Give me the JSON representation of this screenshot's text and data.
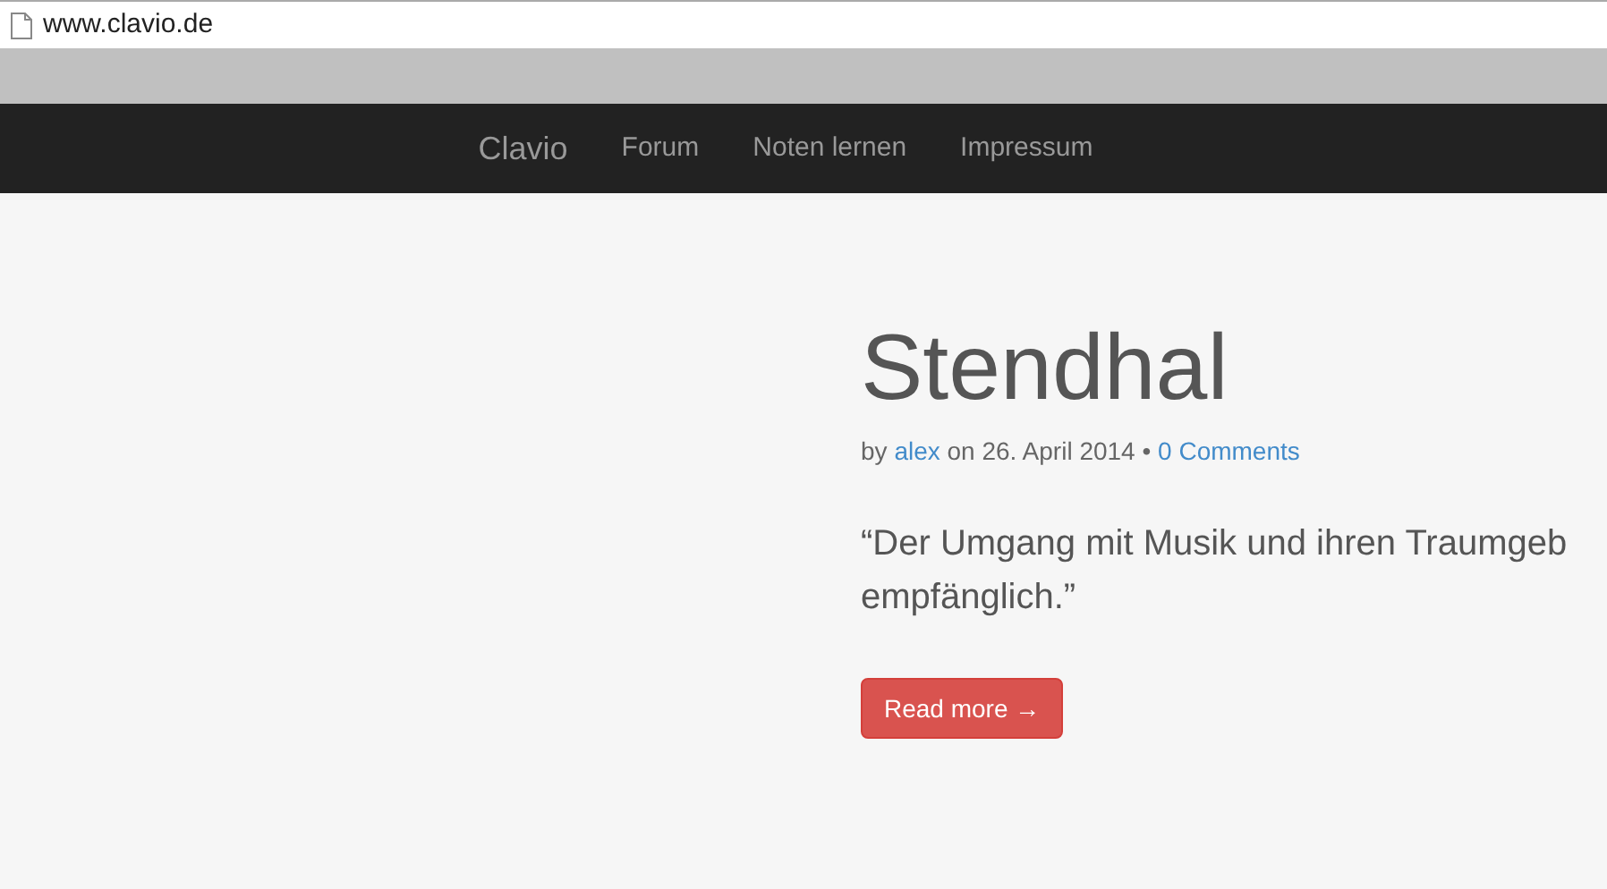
{
  "address_bar": {
    "url": "www.clavio.de"
  },
  "navbar": {
    "brand": "Clavio",
    "links": [
      "Forum",
      "Noten lernen",
      "Impressum"
    ]
  },
  "post": {
    "title": "Stendhal",
    "meta": {
      "by": "by",
      "author": "alex",
      "date": "on 26. April 2014 •",
      "comments": "0 Comments"
    },
    "excerpt_lines": [
      "“Der Umgang mit Musik und ihren Traumgeb",
      "empfänglich.”"
    ],
    "read_more": "Read more →"
  }
}
